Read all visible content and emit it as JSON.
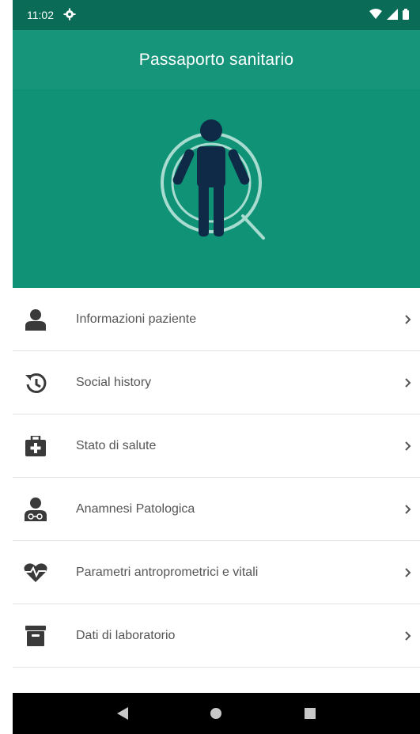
{
  "status_bar": {
    "time": "11:02",
    "icons": [
      "gear-icon",
      "wifi-icon",
      "signal-icon",
      "battery-icon"
    ]
  },
  "app_bar": {
    "title": "Passaporto sanitario"
  },
  "colors": {
    "status_bar": "#0a6b56",
    "app_bar": "#16957b",
    "hero": "#0f9276",
    "figure": "#0e2a47",
    "icon": "#3a3a3a",
    "label": "#555555"
  },
  "hero": {
    "icon": "person-search-icon"
  },
  "menu": {
    "items": [
      {
        "label": "Informazioni paziente",
        "icon": "person-icon"
      },
      {
        "label": "Social history",
        "icon": "history-icon"
      },
      {
        "label": "Stato di salute",
        "icon": "medical-bag-icon"
      },
      {
        "label": "Anamnesi Patologica",
        "icon": "doctor-icon"
      },
      {
        "label": "Parametri antroprometrici e vitali",
        "icon": "heart-pulse-icon"
      },
      {
        "label": "Dati di laboratorio",
        "icon": "archive-icon"
      }
    ]
  },
  "nav_bar": {
    "icons": [
      "back-icon",
      "home-icon",
      "recents-icon"
    ]
  }
}
